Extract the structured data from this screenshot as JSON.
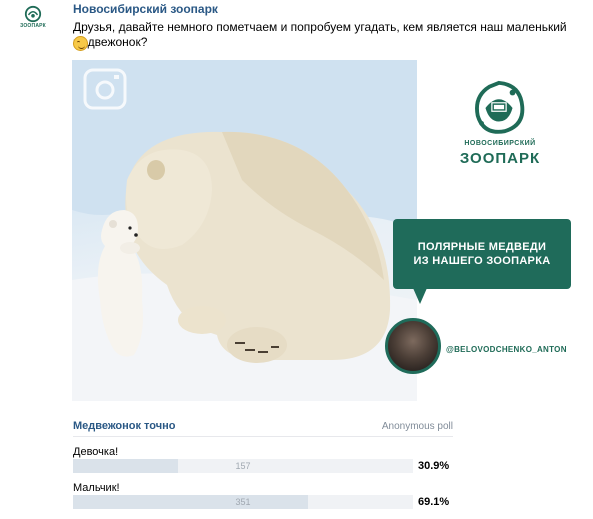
{
  "post": {
    "author": "Новосибирский зоопарк",
    "avatar_text": "ЗООПАРК",
    "text": "Друзья, давайте немного пометчаем и попробуем угадать, кем является наш маленький медвежонок?",
    "emoji": "wink-emoji"
  },
  "image": {
    "logo_line1": "НОВОСИБИРСКИЙ",
    "logo_line2": "ЗООПАРК",
    "bubble_line1": "ПОЛЯРНЫЕ МЕДВЕДИ",
    "bubble_line2": "ИЗ НАШЕГО ЗООПАРКА",
    "handle": "@BELOVODCHENKO_ANTON",
    "watermark_icon": "instagram-icon"
  },
  "poll": {
    "title": "Медвежонок точно",
    "type": "Anonymous poll",
    "options": [
      {
        "label": "Девочка!",
        "count": "157",
        "percent": "30.9%",
        "fraction": 0.309
      },
      {
        "label": "Мальчик!",
        "count": "351",
        "percent": "69.1%",
        "fraction": 0.691
      }
    ]
  },
  "colors": {
    "link": "#2a5885",
    "brand_green": "#1f6b5a",
    "bar_bg": "#f0f2f5",
    "bar_fill": "#dae2ea"
  }
}
